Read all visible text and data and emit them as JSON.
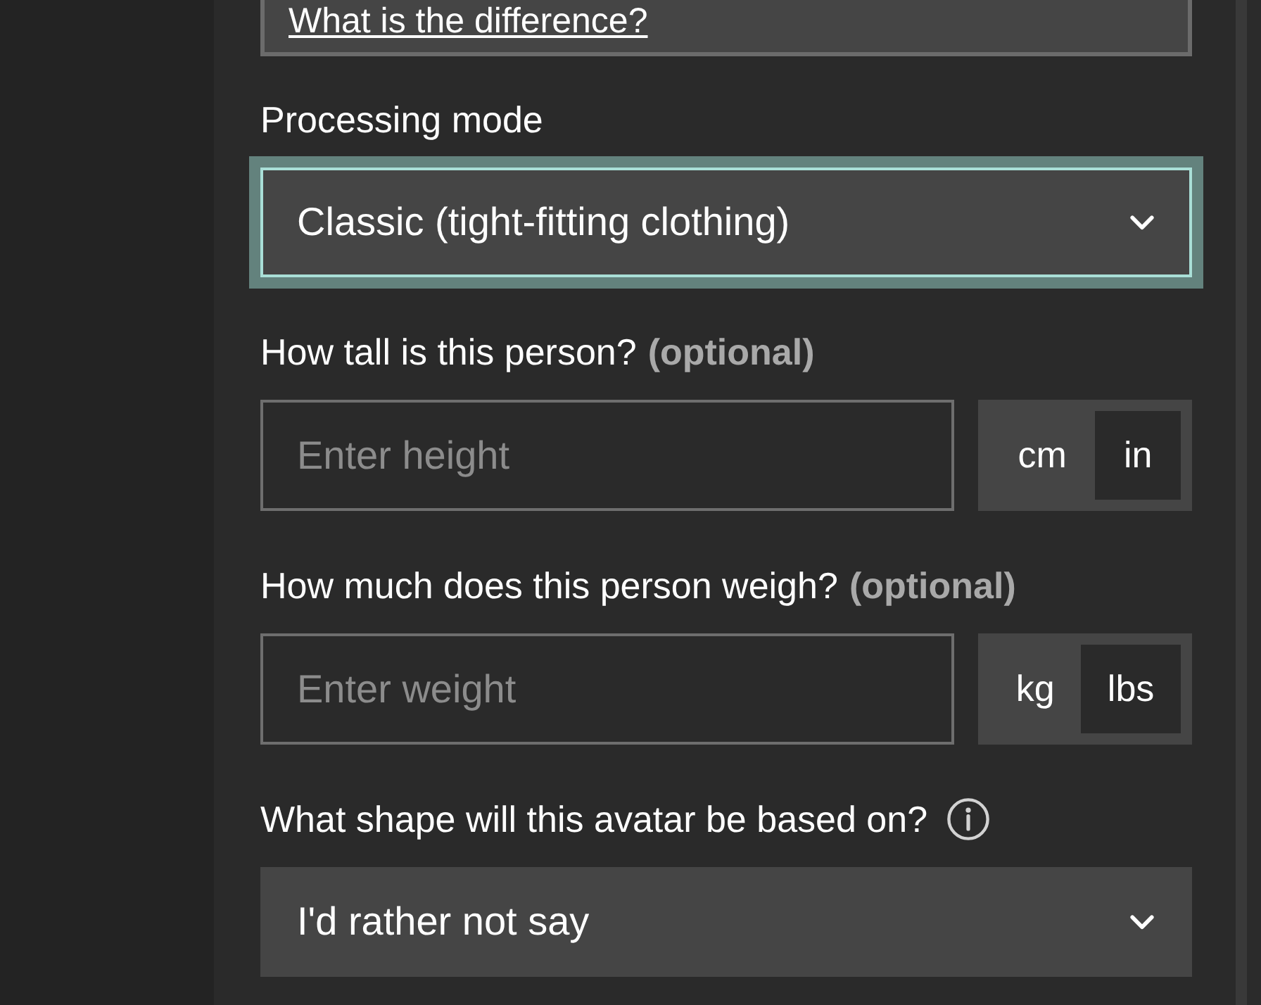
{
  "note": {
    "link": "What is the difference?"
  },
  "fields": [
    {
      "kind": "select",
      "label": "Processing mode",
      "value": "Classic (tight-fitting clothing)",
      "focused": true,
      "info": false
    },
    {
      "kind": "measure",
      "label": "How tall is this person?",
      "hint": "(optional)",
      "placeholder": "Enter height",
      "units": [
        {
          "label": "cm",
          "selected": false
        },
        {
          "label": "in",
          "selected": true
        }
      ]
    },
    {
      "kind": "measure",
      "label": "How much does this person weigh?",
      "hint": "(optional)",
      "placeholder": "Enter weight",
      "units": [
        {
          "label": "kg",
          "selected": false
        },
        {
          "label": "lbs",
          "selected": true
        }
      ]
    },
    {
      "kind": "select",
      "label": "What shape will this avatar be based on?",
      "value": "I'd rather not say",
      "focused": false,
      "info": true
    }
  ]
}
